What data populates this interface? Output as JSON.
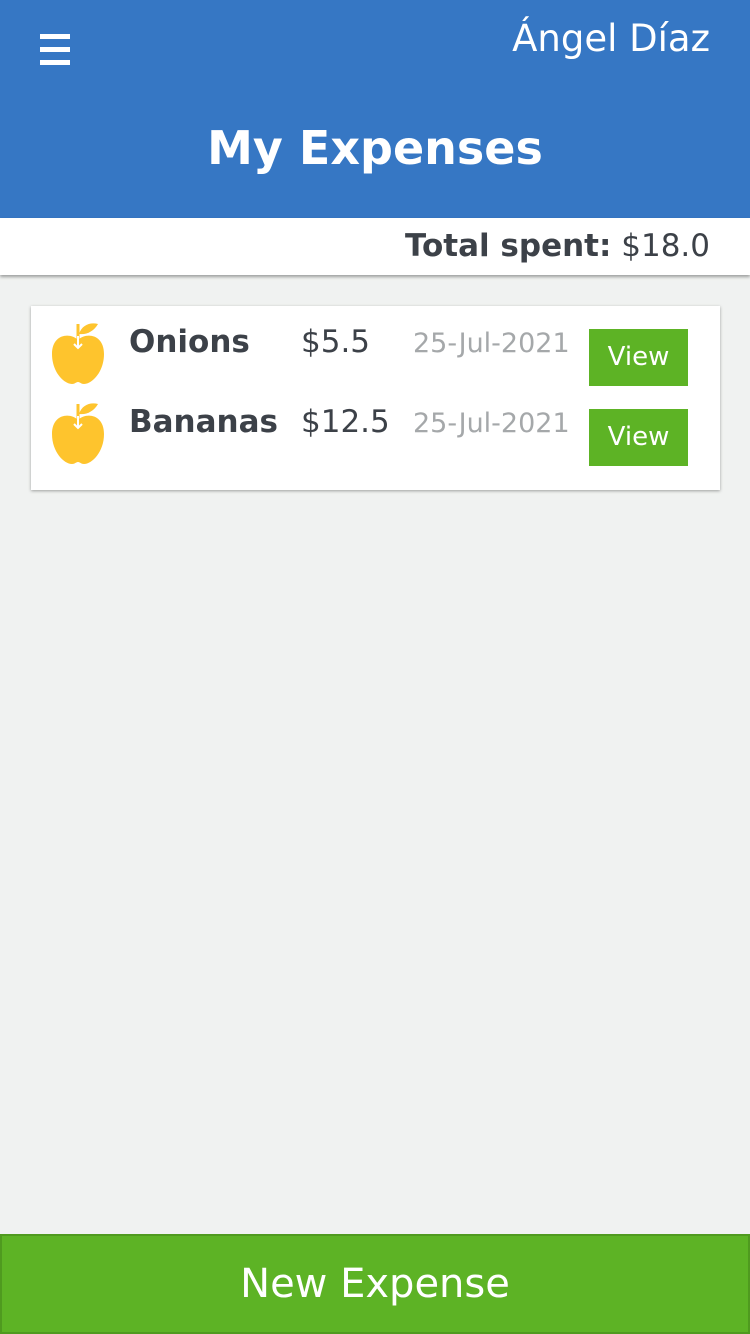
{
  "header": {
    "user_name": "Ángel Díaz",
    "title": "My Expenses",
    "menu_icon": "hamburger-menu-icon"
  },
  "summary": {
    "total_label": "Total spent:",
    "total_value": "$18.0"
  },
  "expenses": [
    {
      "icon": "apple-icon",
      "name": "Onions",
      "amount": "$5.5",
      "date": "25-Jul-2021",
      "action": "View"
    },
    {
      "icon": "apple-icon",
      "name": "Bananas",
      "amount": "$12.5",
      "date": "25-Jul-2021",
      "action": "View"
    }
  ],
  "footer": {
    "new_expense_label": "New Expense"
  },
  "colors": {
    "header_bg": "#3677c4",
    "accent_green": "#5db325",
    "icon_yellow": "#fec42d",
    "background": "#f0f2f1"
  }
}
